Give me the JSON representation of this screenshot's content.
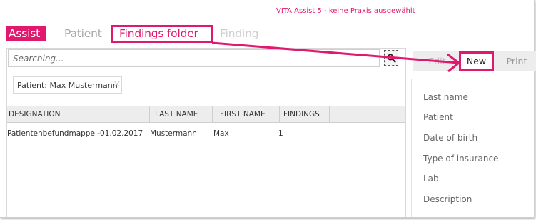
{
  "app": {
    "title": "VITA Assist 5 - keine Praxis ausgewählt"
  },
  "tabs": {
    "assist": "Assist",
    "patient": "Patient",
    "findings_folder": "Findings folder",
    "finding": "Finding"
  },
  "search": {
    "placeholder": "Searching..."
  },
  "filter": {
    "chip_label": "Patient: Max Mustermann",
    "close_glyph": "×"
  },
  "table": {
    "columns": {
      "designation": "DESIGNATION",
      "last_name": "LAST NAME",
      "first_name": "FIRST NAME",
      "findings": "FINDINGS"
    },
    "rows": [
      {
        "designation": "Patientenbefundmappe -01.02.2017",
        "last_name": "Mustermann",
        "first_name": "Max",
        "findings": "1"
      }
    ]
  },
  "toolbar": {
    "edit": "Edit",
    "new": "New",
    "print": "Print"
  },
  "details": {
    "fields": [
      "Last name",
      "Patient",
      "Date of birth",
      "Type of insurance",
      "Lab",
      "Description"
    ]
  },
  "icons": {
    "search": "magnifier-icon"
  },
  "colors": {
    "accent": "#e0196f",
    "header_bg": "#ededed"
  }
}
